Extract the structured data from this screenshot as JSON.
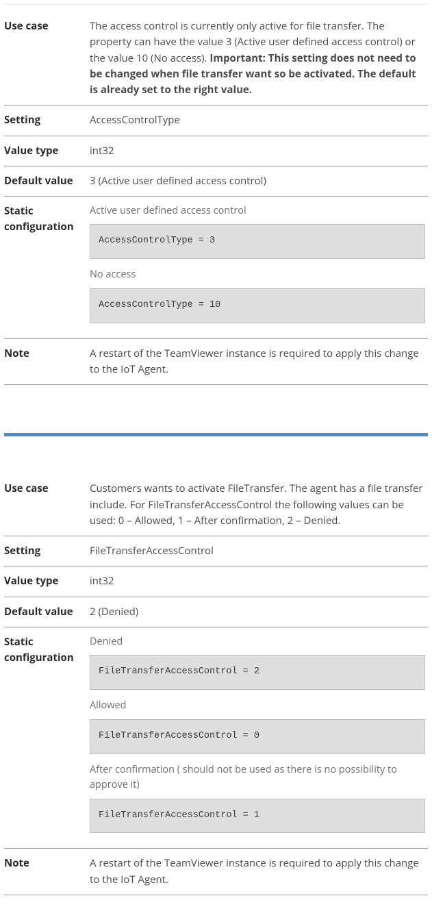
{
  "labels": {
    "use_case": "Use case",
    "setting": "Setting",
    "value_type": "Value type",
    "default_value": "Default value",
    "static_config": "Static configuration",
    "note": "Note"
  },
  "section1": {
    "use_case_pre": "The access control is currently only active for file transfer. The property can have the value 3 (Active user defined access control) or the value 10 (No access). ",
    "use_case_bold": "Important: This setting does not need to be changed when file transfer want so be activated. The default is already set to the right value.",
    "setting": "AccessControlType",
    "value_type": "int32",
    "default_value": "3 (Active user defined access control)",
    "configs": [
      {
        "label": "Active user defined access control",
        "code": "AccessControlType = 3"
      },
      {
        "label": "No access",
        "code": "AccessControlType = 10"
      }
    ],
    "note": "A restart of the TeamViewer instance is required to apply this change to the IoT Agent."
  },
  "section2": {
    "use_case": "Customers wants to activate FileTransfer. The agent has a file transfer include. For FileTransferAccessControl the following values can be used: 0 – Allowed, 1 – After confirmation, 2 – Denied.",
    "setting": "FileTransferAccessControl",
    "value_type": "int32",
    "default_value": "2 (Denied)",
    "configs": [
      {
        "label": "Denied",
        "code": "FileTransferAccessControl = 2"
      },
      {
        "label": "Allowed",
        "code": "FileTransferAccessControl = 0"
      },
      {
        "label": "After confirmation ( should not be used as there is no possibility to approve it)",
        "code": "FileTransferAccessControl = 1"
      }
    ],
    "note": "A restart of the TeamViewer instance is required to apply this change to the IoT Agent."
  }
}
